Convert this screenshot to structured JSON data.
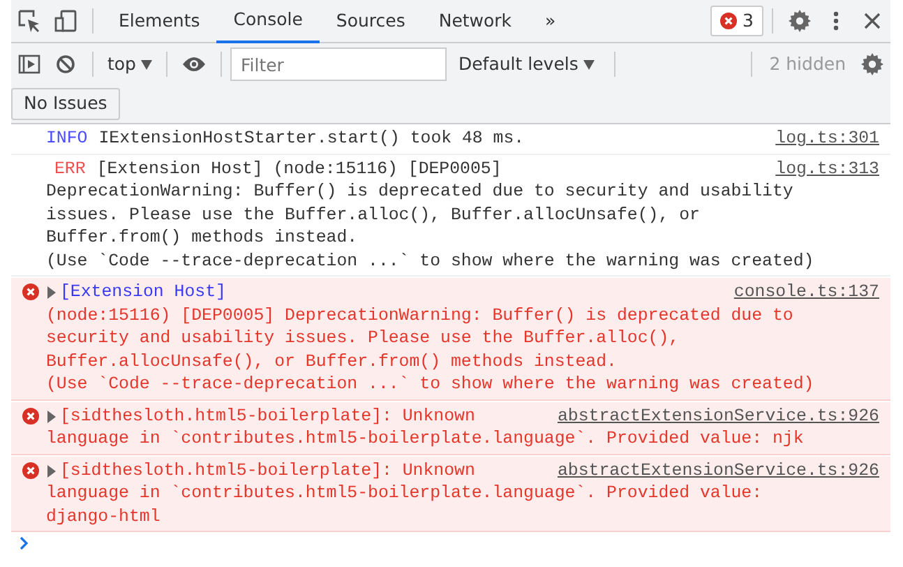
{
  "toolbar": {
    "tabs": [
      {
        "label": "Elements",
        "selected": false
      },
      {
        "label": "Console",
        "selected": true
      },
      {
        "label": "Sources",
        "selected": false
      },
      {
        "label": "Network",
        "selected": false
      }
    ],
    "more_tabs": "»",
    "error_count": "3"
  },
  "console_toolbar": {
    "context": "top",
    "filter": {
      "placeholder": "Filter"
    },
    "levels": "Default levels",
    "hidden_count": "2 hidden"
  },
  "issues_button": "No Issues",
  "messages": [
    {
      "kind": "info",
      "label": "INFO",
      "head": "IExtensionHostStarter.start() took 48 ms.",
      "source": "log.ts:301"
    },
    {
      "kind": "err_log",
      "label": "ERR",
      "head": "[Extension Host] (node:15116) [DEP0005]",
      "body": [
        "DeprecationWarning: Buffer() is deprecated due to security and usability",
        "issues. Please use the Buffer.alloc(), Buffer.allocUnsafe(), or",
        "Buffer.from() methods instead.",
        "(Use `Code --trace-deprecation ...` to show where the warning was created)"
      ],
      "source": "log.ts:313"
    },
    {
      "kind": "error",
      "head_link": true,
      "expanded": false,
      "head": "[Extension Host]",
      "body": [
        "(node:15116) [DEP0005] DeprecationWarning: Buffer() is deprecated due to",
        "security and usability issues. Please use the Buffer.alloc(),",
        "Buffer.allocUnsafe(), or Buffer.from() methods instead.",
        "(Use `Code --trace-deprecation ...` to show where the warning was created)"
      ],
      "source": "console.ts:137"
    },
    {
      "kind": "error",
      "head_link": false,
      "expanded": false,
      "head": "[sidthesloth.html5-boilerplate]: Unknown",
      "body": [
        "language in `contributes.html5-boilerplate.language`. Provided value: njk"
      ],
      "source": "abstractExtensionService.ts:926"
    },
    {
      "kind": "error",
      "head_link": false,
      "expanded": false,
      "head": "[sidthesloth.html5-boilerplate]: Unknown",
      "body": [
        "language in `contributes.html5-boilerplate.language`. Provided value:",
        "django-html"
      ],
      "source": "abstractExtensionService.ts:926"
    }
  ]
}
